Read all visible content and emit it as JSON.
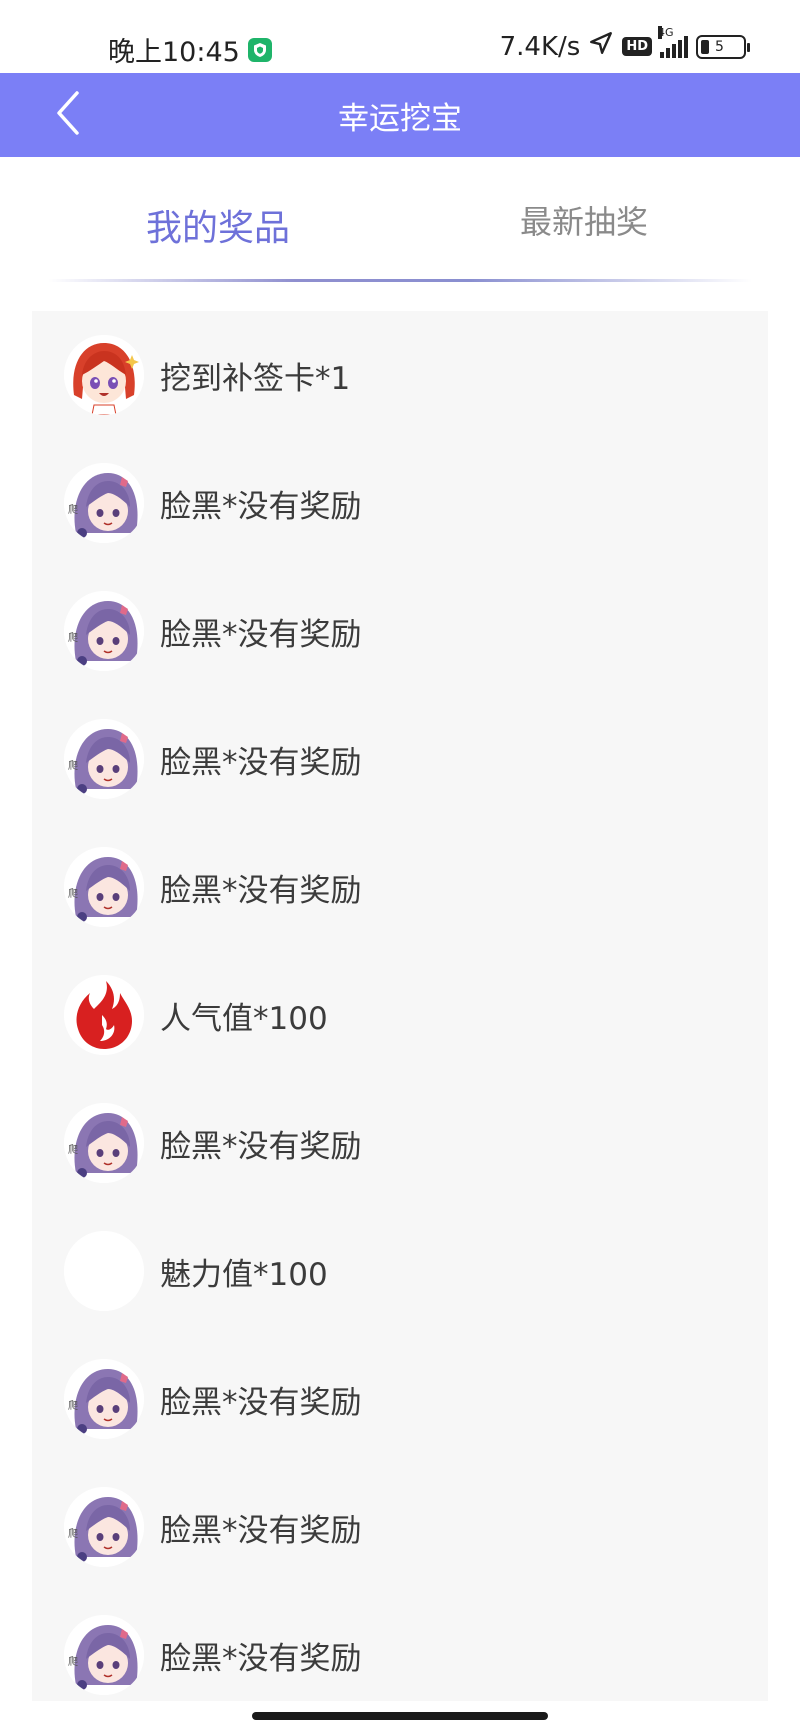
{
  "status_bar": {
    "time": "晚上10:45",
    "net_speed": "7.4K/s",
    "hd_label": "HD",
    "network_type": "4G",
    "battery_level": "5",
    "icons": [
      "shield-icon",
      "location-arrow-icon",
      "signal-icon",
      "battery-icon"
    ]
  },
  "app_bar": {
    "title": "幸运挖宝",
    "back_icon": "chevron-left-icon",
    "background_color": "#7b7ff6"
  },
  "tabs": [
    {
      "label": "我的奖品",
      "active": true,
      "color": "#6e71d9"
    },
    {
      "label": "最新抽奖",
      "active": false,
      "color": "#8a8a8a"
    }
  ],
  "prizes": [
    {
      "icon": "redhair-girl-avatar",
      "text": "挖到补签卡*1"
    },
    {
      "icon": "purplehair-girl-avatar",
      "text": "脸黑*没有奖励"
    },
    {
      "icon": "purplehair-girl-avatar",
      "text": "脸黑*没有奖励"
    },
    {
      "icon": "purplehair-girl-avatar",
      "text": "脸黑*没有奖励"
    },
    {
      "icon": "purplehair-girl-avatar",
      "text": "脸黑*没有奖励"
    },
    {
      "icon": "fire-icon",
      "text": "人气值*100"
    },
    {
      "icon": "purplehair-girl-avatar",
      "text": "脸黑*没有奖励"
    },
    {
      "icon": "blank-avatar",
      "text": "魅力值*100"
    },
    {
      "icon": "purplehair-girl-avatar",
      "text": "脸黑*没有奖励"
    },
    {
      "icon": "purplehair-girl-avatar",
      "text": "脸黑*没有奖励"
    },
    {
      "icon": "purplehair-girl-avatar",
      "text": "脸黑*没有奖励"
    }
  ]
}
